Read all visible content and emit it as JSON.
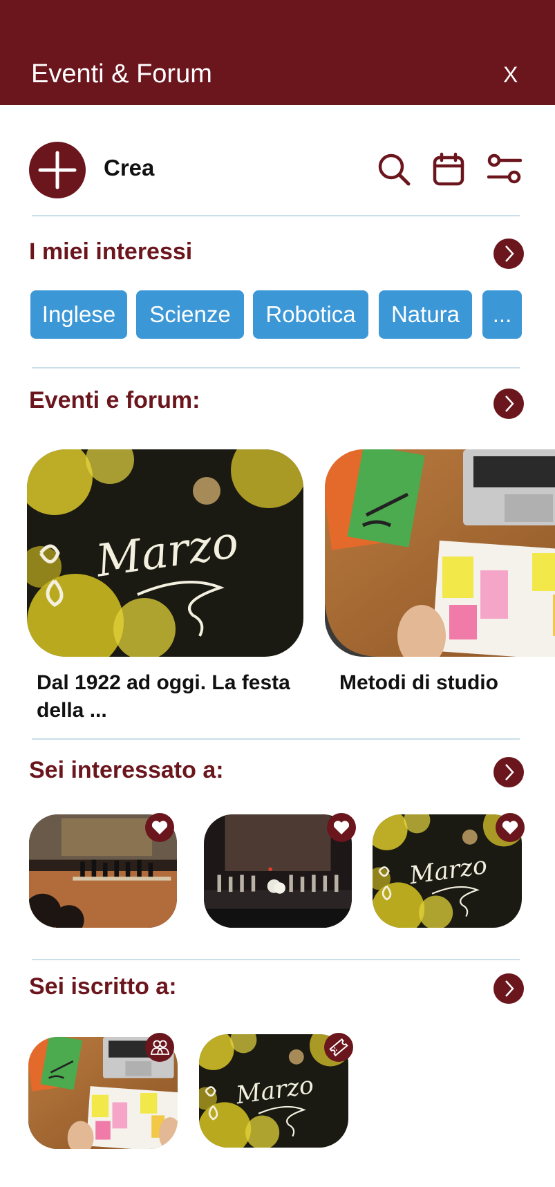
{
  "header": {
    "title": "Eventi & Forum",
    "close_label": "X"
  },
  "toolbar": {
    "create_label": "Crea",
    "icons": [
      "search-icon",
      "calendar-icon",
      "filter-icon"
    ]
  },
  "interests": {
    "title": "I miei interessi",
    "chips": [
      "Inglese",
      "Scienze",
      "Robotica",
      "Natura",
      "..."
    ]
  },
  "events": {
    "title": "Eventi e forum:",
    "cards": [
      {
        "title": "Dal 1922 ad oggi. La festa della ...",
        "image": "8-marzo-chalkboard-mimosa"
      },
      {
        "title": "Metodi di studio",
        "image": "study-desk-laptop-notebook"
      }
    ]
  },
  "interested": {
    "title": "Sei interessato a:",
    "items": [
      {
        "image": "concert-hall-orchestra",
        "badge_icon": "heart-icon"
      },
      {
        "image": "theatre-stage-performance",
        "badge_icon": "heart-icon"
      },
      {
        "image": "8-marzo-chalkboard-mimosa",
        "badge_icon": "heart-icon"
      }
    ]
  },
  "subscribed": {
    "title": "Sei iscritto a:",
    "items": [
      {
        "image": "study-desk-laptop-notebook",
        "badge_icon": "group-icon"
      },
      {
        "image": "8-marzo-chalkboard-mimosa",
        "badge_icon": "ticket-icon"
      }
    ]
  },
  "colors": {
    "brand": "#6b151d",
    "chip": "#3b97d6",
    "divider": "#c9dfe7"
  }
}
